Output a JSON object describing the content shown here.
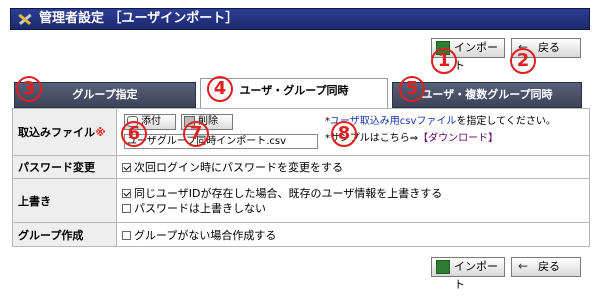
{
  "title": "管理者設定 ［ユーザインポート］",
  "buttons": {
    "import": "インポート",
    "back": "戻る"
  },
  "markers": [
    "1",
    "2",
    "3",
    "4",
    "5",
    "6",
    "7",
    "8"
  ],
  "tabs": [
    {
      "label": "グループ指定",
      "state": "inactive"
    },
    {
      "label": "ユーザ・グループ同時",
      "state": "active"
    },
    {
      "label": "ユーザ・複数グループ同時",
      "state": "inactive"
    }
  ],
  "form": {
    "file": {
      "label": "取込みファイル",
      "required_mark": "※",
      "attach_label": "添付",
      "delete_label": "削除",
      "file_name": "ユーザグループ同時インポート.csv",
      "note_prefix": "*",
      "note_link": "ユーザ取込み用csvファイル",
      "note_suffix": "を指定してください。",
      "sample_prefix": "*サンプルはこちら⇒",
      "sample_link": "【ダウンロード】"
    },
    "password_change": {
      "label": "パスワード変更",
      "option": "次回ログイン時にパスワードを変更をする",
      "checked": true
    },
    "overwrite": {
      "label": "上書き",
      "option1": "同じユーザIDが存在した場合、既存のユーザ情報を上書きする",
      "option1_checked": true,
      "option2": "パスワードは上書きしない",
      "option2_checked": false
    },
    "group_create": {
      "label": "グループ作成",
      "option": "グループがない場合作成する",
      "checked": false
    }
  },
  "colors": {
    "titlebar": "#2c3e94",
    "marker": "#e02020",
    "tab_dark": "#4a5268",
    "link": "#660066"
  }
}
